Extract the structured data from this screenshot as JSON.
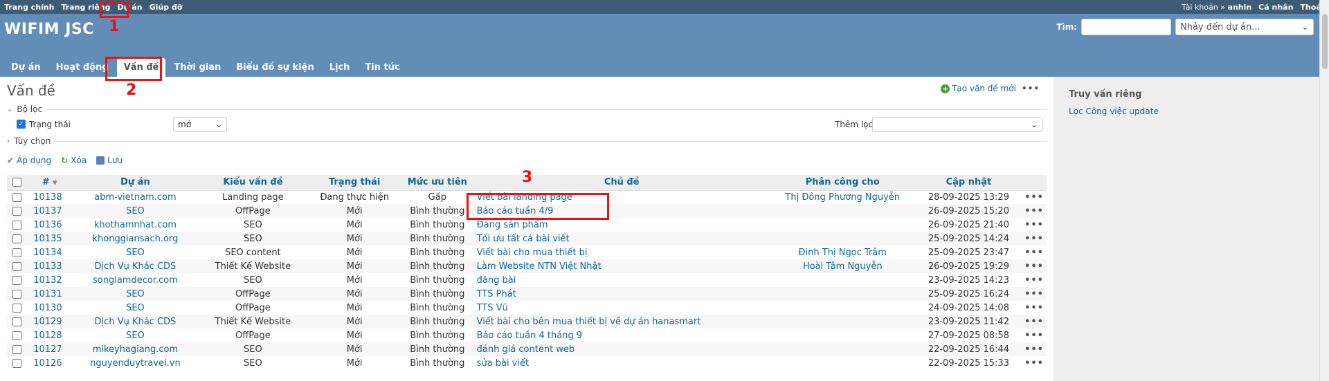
{
  "top_menu": {
    "left": [
      "Trang chính",
      "Trang riêng",
      "Dự án",
      "Giúp đỡ"
    ],
    "account_prefix": "Tài khoản »",
    "account_user": "anhln",
    "personal": "Cá nhân",
    "logout": "Thoát"
  },
  "header": {
    "title": "WIFIM JSC",
    "search_label": "Tìm:",
    "search_value": "",
    "jump_placeholder": "Nhảy đến dự án..."
  },
  "main_menu": [
    "Dự án",
    "Hoạt động",
    "Vấn đề",
    "Thời gian",
    "Biểu đồ sự kiện",
    "Lịch",
    "Tin tức"
  ],
  "page": {
    "title": "Vấn đề",
    "new_issue": "Tạo vấn đề mới",
    "filter_legend": "Bộ lọc",
    "status_label": "Trạng thái",
    "status_value": "mở",
    "add_filter_label": "Thêm lọc",
    "options_legend": "Tùy chọn",
    "apply": "Áp dụng",
    "clear": "Xóa",
    "save": "Lưu"
  },
  "table": {
    "headers": [
      "#",
      "Dự án",
      "Kiểu vấn đề",
      "Trạng thái",
      "Mức ưu tiên",
      "Chủ đề",
      "Phân công cho",
      "Cập nhật"
    ],
    "rows": [
      [
        "10138",
        "abm-vietnam.com",
        "Landing page",
        "Đang thực hiện",
        "Gấp",
        "Viết bài landing page",
        "Thị Đông Phương Nguyễn",
        "28-09-2025 13:29"
      ],
      [
        "10137",
        "SEO",
        "OffPage",
        "Mới",
        "Bình thường",
        "Báo cáo tuần 4/9",
        "",
        "26-09-2025 15:20"
      ],
      [
        "10136",
        "khothamnhat.com",
        "SEO",
        "Mới",
        "Bình thường",
        "Đăng sản phẩm",
        "",
        "26-09-2025 21:40"
      ],
      [
        "10135",
        "khonggiansach.org",
        "SEO",
        "Mới",
        "Bình thường",
        "Tối ưu tất cả bài viết",
        "",
        "25-09-2025 14:24"
      ],
      [
        "10134",
        "SEO",
        "SEO content",
        "Mới",
        "Bình thường",
        "Viết bài cho mua thiết bị",
        "Đinh Thị Ngọc Trâm",
        "25-09-2025 23:47"
      ],
      [
        "10133",
        "Dịch Vụ Khác CDS",
        "Thiết Kế Website",
        "Mới",
        "Bình thường",
        "Làm Website NTN Việt Nhật",
        "Hoài Tâm Nguyễn",
        "26-09-2025 19:29"
      ],
      [
        "10132",
        "songlamdecor.com",
        "SEO",
        "Mới",
        "Bình thường",
        "đăng bài",
        "",
        "23-09-2025 14:23"
      ],
      [
        "10131",
        "SEO",
        "OffPage",
        "Mới",
        "Bình thường",
        "TTS Phát",
        "",
        "25-09-2025 16:24"
      ],
      [
        "10130",
        "SEO",
        "OffPage",
        "Mới",
        "Bình thường",
        "TTS Vũ",
        "",
        "24-09-2025 14:08"
      ],
      [
        "10129",
        "Dịch Vụ Khác CDS",
        "Thiết Kế Website",
        "Mới",
        "Bình thường",
        "Viết bài cho bên mua thiết bị về dự án hanasmart",
        "",
        "23-09-2025 11:42"
      ],
      [
        "10128",
        "SEO",
        "OffPage",
        "Mới",
        "Bình thường",
        "Báo cáo tuần 4 tháng 9",
        "",
        "27-09-2025 08:58"
      ],
      [
        "10127",
        "mikeyhagiang.com",
        "SEO",
        "Mới",
        "Bình thường",
        "đánh giá content web",
        "",
        "22-09-2025 16:44"
      ],
      [
        "10126",
        "nguyenduytravel.vn",
        "SEO",
        "Mới",
        "Bình thường",
        "sửa bài viết",
        "",
        "22-09-2025 15:33"
      ]
    ]
  },
  "sidebar": {
    "title": "Truy vấn riêng",
    "link": "Lọc Công việc update"
  },
  "annotations": [
    "1",
    "2",
    "3"
  ]
}
